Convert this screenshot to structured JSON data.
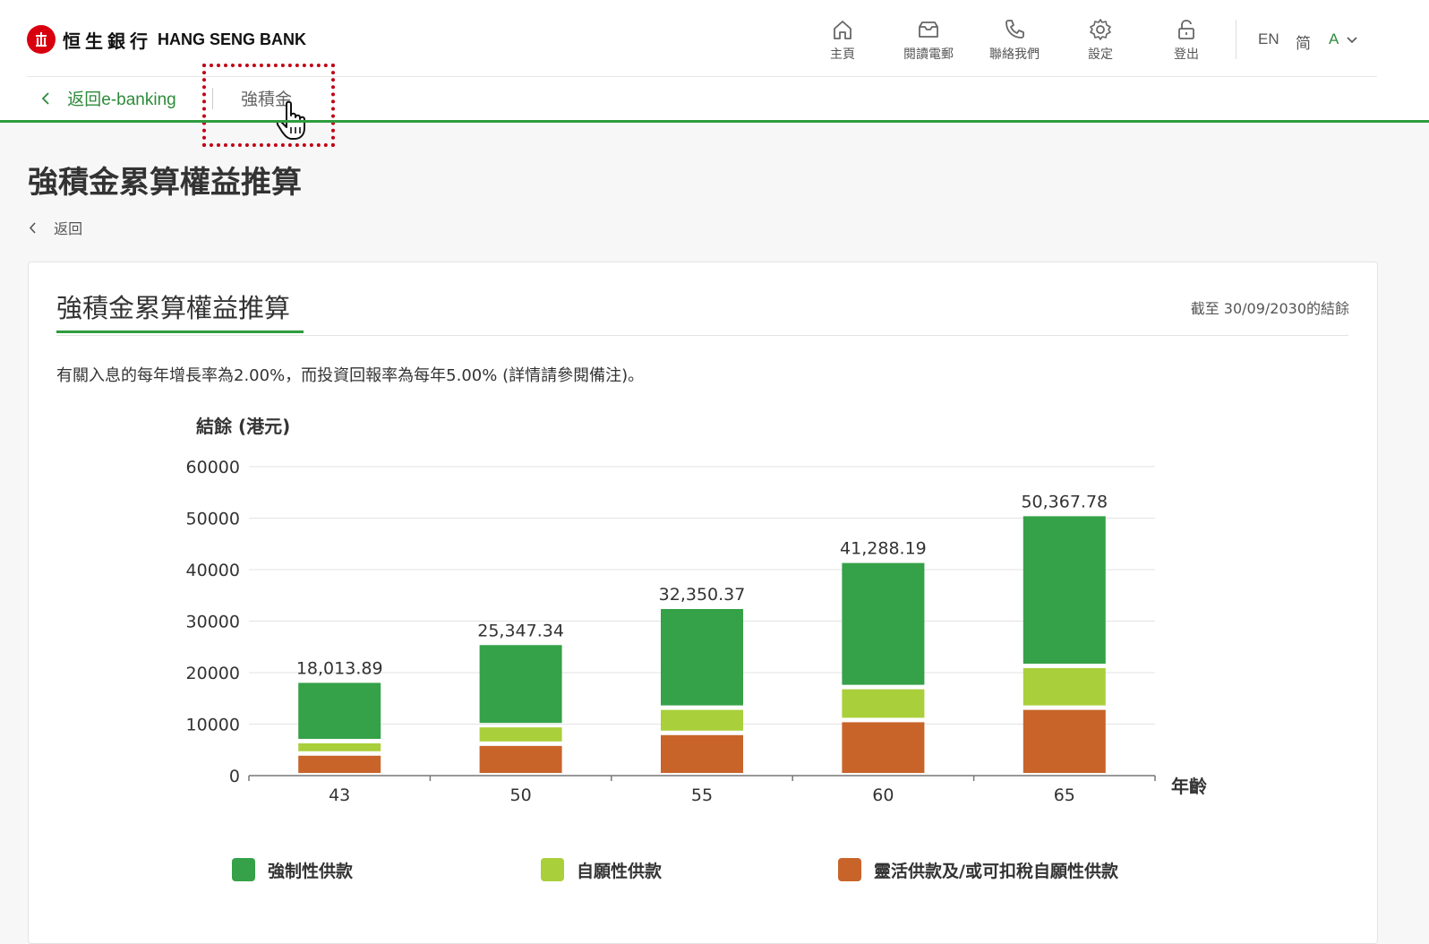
{
  "header": {
    "logo_cn": "恒生銀行",
    "logo_en": "HANG SENG BANK",
    "nav": [
      {
        "label": "主頁",
        "icon": "home-icon"
      },
      {
        "label": "閱讀電郵",
        "icon": "inbox-icon"
      },
      {
        "label": "聯絡我們",
        "icon": "phone-icon"
      },
      {
        "label": "設定",
        "icon": "gear-icon"
      },
      {
        "label": "登出",
        "icon": "unlock-icon"
      }
    ],
    "lang_en": "EN",
    "lang_sc": "简",
    "font_size_label": "A"
  },
  "breadcrumb": {
    "back_label": "返回e-banking",
    "current_tab": "強積金"
  },
  "page": {
    "title": "強積金累算權益推算",
    "back_label": "返回"
  },
  "card": {
    "title": "強積金累算權益推算",
    "as_of": "截至 30/09/2030的結餘",
    "note": "有關入息的每年增長率為2.00%，而投資回報率為每年5.00% (詳情請參閱備注)。"
  },
  "colors": {
    "brand_green": "#2e9c3f",
    "brand_red": "#d8000f",
    "highlight_red": "#c00014"
  },
  "chart_data": {
    "type": "bar",
    "stacked": true,
    "ylabel": "結餘 (港元)",
    "xlabel": "年齡",
    "ylim": [
      0,
      60000
    ],
    "yticks": [
      0,
      10000,
      20000,
      30000,
      40000,
      50000,
      60000
    ],
    "categories": [
      "43",
      "50",
      "55",
      "60",
      "65"
    ],
    "totals": [
      "18,013.89",
      "25,347.34",
      "32,350.37",
      "41,288.19",
      "50,367.78"
    ],
    "series": [
      {
        "name": "靈活供款及/或可扣稅自願性供款",
        "color": "#c8642a",
        "values": [
          4300,
          6200,
          8300,
          10800,
          13200
        ]
      },
      {
        "name": "自願性供款",
        "color": "#a9cf3a",
        "values": [
          2400,
          3600,
          4900,
          6400,
          8100
        ]
      },
      {
        "name": "強制性供款",
        "color": "#35a148",
        "values": [
          11314,
          15547,
          19150,
          24088,
          29068
        ]
      }
    ],
    "legend_position": "bottom",
    "grid": true
  }
}
